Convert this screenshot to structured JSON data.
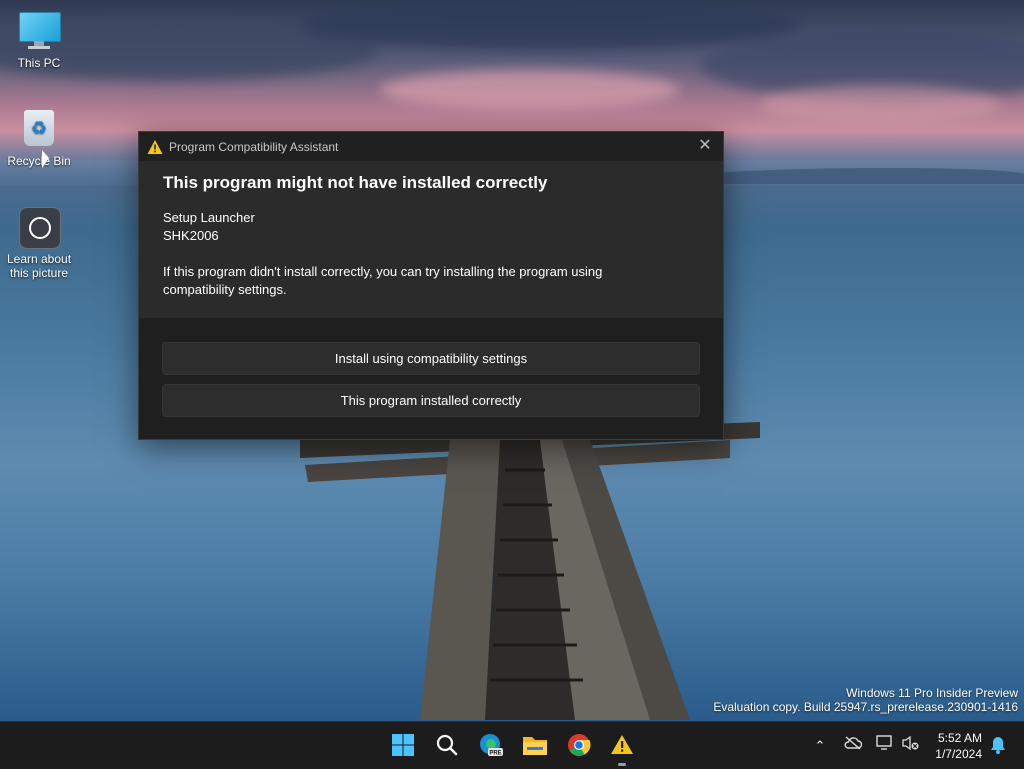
{
  "desktop": {
    "icons": [
      {
        "label": "This PC"
      },
      {
        "label": "Recycle Bin"
      },
      {
        "label": "Learn about this picture"
      }
    ],
    "watermark": {
      "line1": "Windows 11 Pro Insider Preview",
      "line2": "Evaluation copy. Build 25947.rs_prerelease.230901-1416"
    }
  },
  "dialog": {
    "title": "Program Compatibility Assistant",
    "heading": "This program might not have installed correctly",
    "program_name": "Setup Launcher",
    "publisher": "SHK2006",
    "description": "If this program didn't install correctly, you can try installing the program using compatibility settings.",
    "buttons": {
      "install_compat": "Install using compatibility settings",
      "installed_ok": "This program installed correctly"
    },
    "close_glyph": "✕"
  },
  "taskbar": {
    "apps": [
      "start-icon",
      "search-icon",
      "edge-preview-icon",
      "file-explorer-icon",
      "chrome-icon",
      "compatibility-warning-icon"
    ],
    "clock": {
      "time": "5:52 AM",
      "date": "1/7/2024"
    }
  },
  "colors": {
    "dialog_bg": "#2b2b2b",
    "dialog_footer": "#1f1f1f",
    "taskbar": "#1c1c1c",
    "warning": "#f5c518",
    "accent": "#4cc2ff"
  }
}
